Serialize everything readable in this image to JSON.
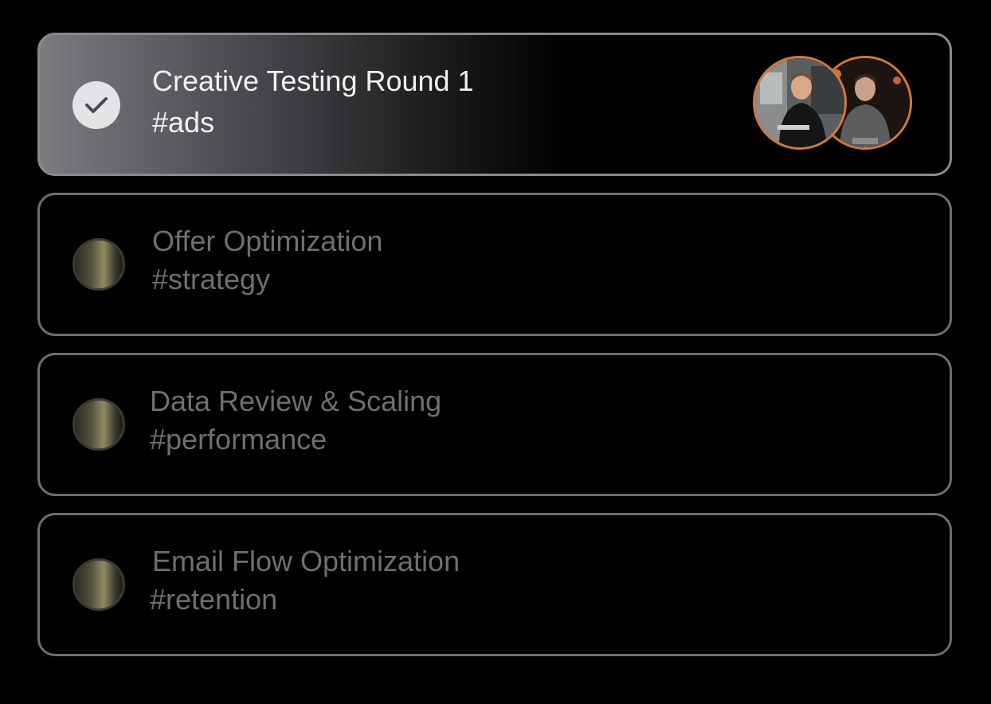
{
  "tasks": [
    {
      "title": "Creative Testing Round 1",
      "tag": "#ads",
      "status": "completed",
      "assignees": [
        "avatar-1",
        "avatar-2"
      ]
    },
    {
      "title": "Offer Optimization",
      "tag": "#strategy",
      "status": "pending"
    },
    {
      "title": "Data Review & Scaling",
      "tag": "#performance",
      "status": "pending"
    },
    {
      "title": "Email Flow Optimization",
      "tag": "#retention",
      "status": "pending"
    }
  ],
  "colors": {
    "background": "#000000",
    "card_border": "#6e6e6e",
    "avatar_ring": "#d07a3c",
    "text_active": "#f1f1f1",
    "text_muted": "#6f6f6f"
  },
  "icons": {
    "completed": "check-icon",
    "pending": "circle-icon"
  }
}
